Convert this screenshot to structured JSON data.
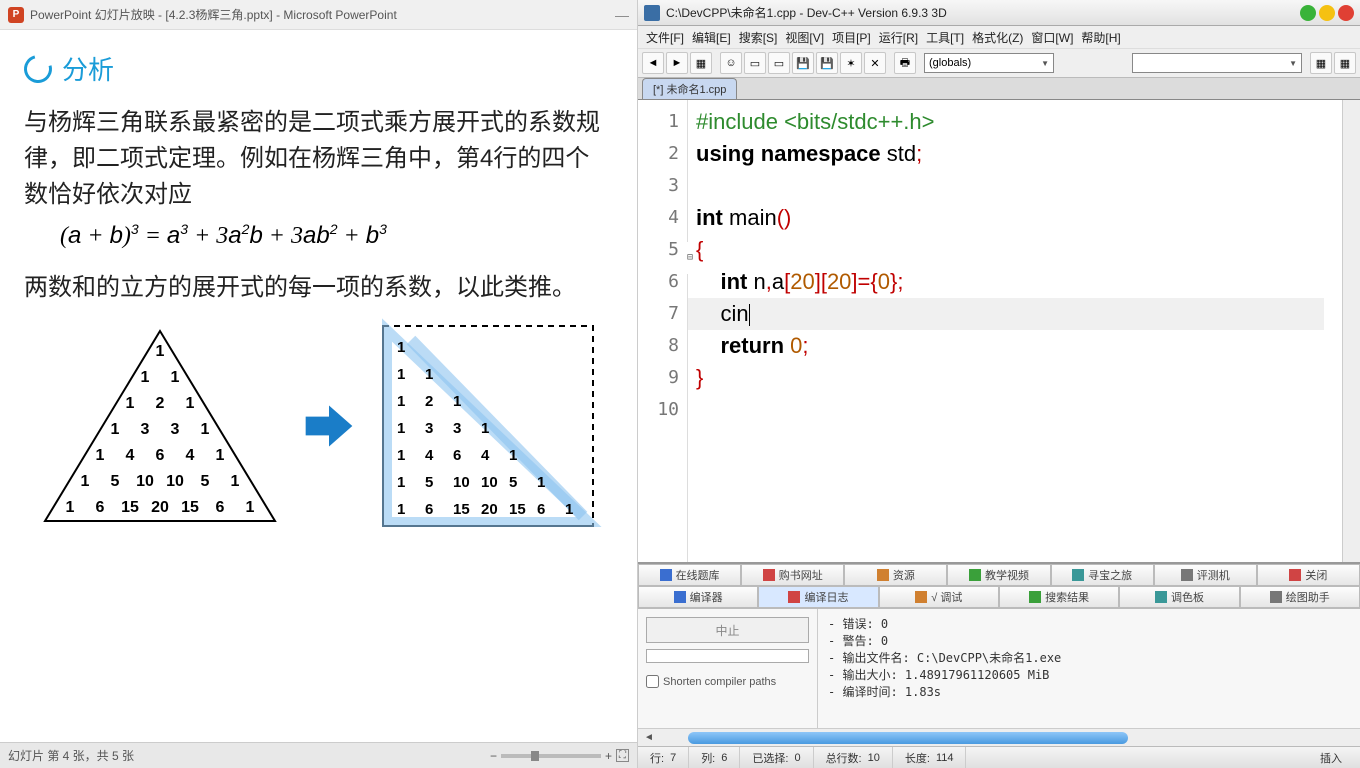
{
  "powerpoint": {
    "title": "PowerPoint 幻灯片放映 - [4.2.3杨辉三角.pptx] - Microsoft PowerPoint",
    "analysis_label": "分析",
    "para1": "与杨辉三角联系最紧密的是二项式乘方展开式的系数规律，即二项式定理。例如在杨辉三角中，第4行的四个数恰好依次对应",
    "formula_html": "(a + b)³ = a³ + 3a²b + 3ab² + b³",
    "para2": "两数和的立方的展开式的每一项的系数，以此类推。",
    "pascal_rows": [
      [
        1
      ],
      [
        1,
        1
      ],
      [
        1,
        2,
        1
      ],
      [
        1,
        3,
        3,
        1
      ],
      [
        1,
        4,
        6,
        4,
        1
      ],
      [
        1,
        5,
        10,
        10,
        5,
        1
      ],
      [
        1,
        6,
        15,
        20,
        15,
        6,
        1
      ]
    ],
    "status": "幻灯片 第 4 张，共 5 张"
  },
  "devcpp": {
    "title": "C:\\DevCPP\\未命名1.cpp - Dev-C++ Version 6.9.3  3D",
    "menus": [
      "文件[F]",
      "编辑[E]",
      "搜索[S]",
      "视图[V]",
      "项目[P]",
      "运行[R]",
      "工具[T]",
      "格式化(Z)",
      "窗口[W]",
      "帮助[H]"
    ],
    "combo1": "(globals)",
    "tab": "[*] 未命名1.cpp",
    "code_lines": [
      {
        "n": 1,
        "html": "<span class='pre'>#include &lt;bits/stdc++.h&gt;</span>"
      },
      {
        "n": 2,
        "html": "<span class='kw'>using</span> <span class='kw'>namespace</span> <span class='id'>std</span><span class='br'>;</span>"
      },
      {
        "n": 3,
        "html": ""
      },
      {
        "n": 4,
        "html": "<span class='kw'>int</span> <span class='id'>main</span><span class='br'>()</span>"
      },
      {
        "n": 5,
        "html": "<span class='br'>{</span>"
      },
      {
        "n": 6,
        "html": "    <span class='kw'>int</span> <span class='id'>n</span><span class='br'>,</span><span class='id'>a</span><span class='br'>[</span><span class='num'>20</span><span class='br'>][</span><span class='num'>20</span><span class='br'>]={</span><span class='num'>0</span><span class='br'>};</span>"
      },
      {
        "n": 7,
        "html": "    <span class='id'>cin</span><span class='cursor'></span>"
      },
      {
        "n": 8,
        "html": "    <span class='kw'>return</span> <span class='num'>0</span><span class='br'>;</span>"
      },
      {
        "n": 9,
        "html": "<span class='br'>}</span>"
      },
      {
        "n": 10,
        "html": ""
      }
    ],
    "panel_tabs_top": [
      "在线题库",
      "购书网址",
      "资源",
      "教学视频",
      "寻宝之旅",
      "评测机",
      "关闭"
    ],
    "panel_tabs_bot": [
      "编译器",
      "编译日志",
      "√ 调试",
      "搜索结果",
      "调色板",
      "绘图助手"
    ],
    "stop_btn": "中止",
    "shorten_label": "Shorten compiler paths",
    "compile_output": "- 错误: 0\n- 警告: 0\n- 输出文件名: C:\\DevCPP\\未命名1.exe\n- 输出大小: 1.48917961120605 MiB\n- 编译时间: 1.83s",
    "status": {
      "line_lbl": "行:",
      "line": "7",
      "col_lbl": "列:",
      "col": "6",
      "sel_lbl": "已选择:",
      "sel": "0",
      "tot_lbl": "总行数:",
      "tot": "10",
      "len_lbl": "长度:",
      "len": "114",
      "mode": "插入"
    }
  }
}
